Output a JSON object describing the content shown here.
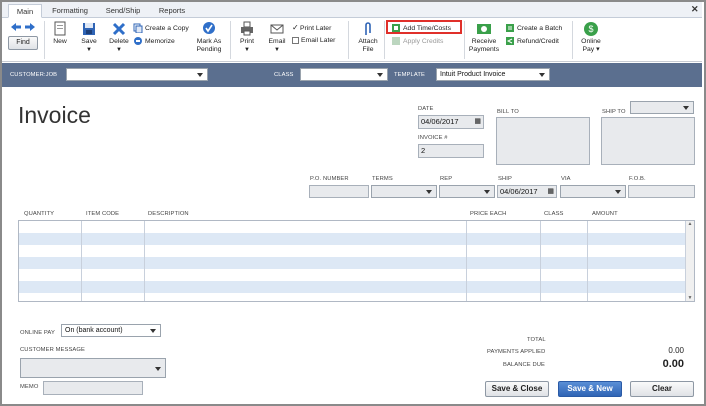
{
  "window": {
    "close_icon": "x-icon"
  },
  "tabs": [
    "Main",
    "Formatting",
    "Send/Ship",
    "Reports"
  ],
  "ribbon": {
    "find": "Find",
    "new": "New",
    "save": "Save",
    "delete": "Delete",
    "create_copy": "Create a Copy",
    "memorize": "Memorize",
    "mark_as": "Mark As",
    "pending": "Pending",
    "print": "Print",
    "email": "Email",
    "print_later": "Print Later",
    "email_later": "Email Later",
    "attach": "Attach",
    "file": "File",
    "add_time_costs": "Add Time/Costs",
    "apply_credits": "Apply Credits",
    "receive": "Receive",
    "payments": "Payments",
    "create_batch": "Create a Batch",
    "refund_credit": "Refund/Credit",
    "online": "Online",
    "pay": "Pay"
  },
  "header": {
    "customer_job_label": "CUSTOMER:JOB",
    "customer_job_value": "",
    "class_label": "CLASS",
    "class_value": "",
    "template_label": "TEMPLATE",
    "template_value": "Intuit Product Invoice"
  },
  "form": {
    "title": "Invoice",
    "date_label": "DATE",
    "date_value": "04/06/2017",
    "invoice_no_label": "INVOICE #",
    "invoice_no_value": "2",
    "bill_to_label": "BILL TO",
    "ship_to_label": "SHIP TO",
    "po_label": "P.O. NUMBER",
    "terms_label": "TERMS",
    "rep_label": "REP",
    "ship_label": "SHIP",
    "ship_value": "04/06/2017",
    "via_label": "VIA",
    "fob_label": "F.O.B."
  },
  "table": {
    "columns": [
      "QUANTITY",
      "ITEM CODE",
      "DESCRIPTION",
      "PRICE EACH",
      "CLASS",
      "AMOUNT"
    ]
  },
  "footer": {
    "online_pay_label": "ONLINE PAY",
    "online_pay_value": "On (bank account)",
    "customer_message_label": "CUSTOMER MESSAGE",
    "memo_label": "MEMO",
    "total_label": "TOTAL",
    "payments_applied_label": "PAYMENTS APPLIED",
    "payments_applied_value": "0.00",
    "balance_due_label": "BALANCE DUE",
    "balance_due_value": "0.00",
    "save_close": "Save & Close",
    "save_new": "Save & New",
    "clear": "Clear"
  },
  "colors": {
    "header_bar": "#5b6f8f",
    "highlight": "#e0302a",
    "row_alt": "#dde8f5"
  }
}
